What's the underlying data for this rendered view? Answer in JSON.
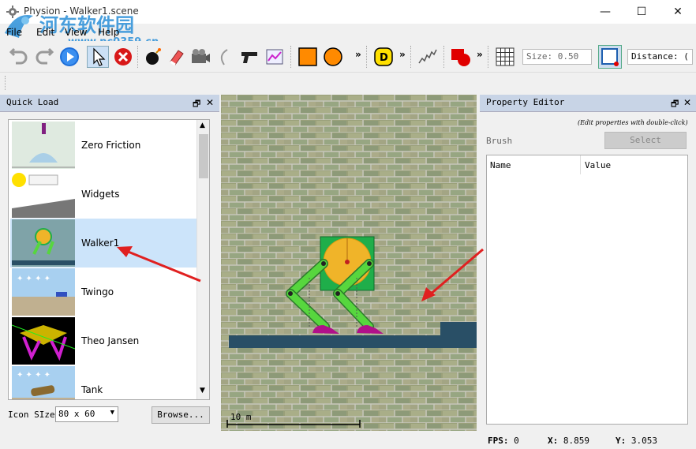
{
  "window": {
    "title": "Physion - Walker1.scene",
    "minimize": "—",
    "maximize": "☐",
    "close": "✕"
  },
  "menu": {
    "file": "File",
    "edit": "Edit",
    "view": "View",
    "help": "Help"
  },
  "watermark": {
    "line1": "河东软件园",
    "line2": "www.pc0359.cn"
  },
  "toolbar": {
    "overflow": "»",
    "size_value": "Size: 0.50",
    "distance_value": "Distance: (",
    "icons": [
      "undo-icon",
      "redo-icon",
      "play-icon",
      "pointer-icon",
      "delete-icon",
      "bomb-icon",
      "eraser-icon",
      "camera-icon",
      "rope-icon",
      "gun-icon",
      "graph-icon",
      "square-icon",
      "circle-icon",
      "d-icon",
      "spring-icon",
      "shape-icon",
      "grid-icon",
      "snap-icon"
    ],
    "colors": {
      "square": "#ff8a00",
      "circle": "#ff8a00",
      "d_badge": "#ffe000",
      "shape": "#e00000",
      "accent": "#1e6fd9"
    }
  },
  "quick_load": {
    "title": "Quick Load",
    "float": "🗗",
    "close": "✕",
    "items": [
      {
        "label": "Zero Friction"
      },
      {
        "label": "Widgets"
      },
      {
        "label": "Walker1",
        "selected": true
      },
      {
        "label": "Twingo"
      },
      {
        "label": "Theo Jansen"
      },
      {
        "label": "Tank"
      }
    ],
    "icon_size_label": "Icon SIze",
    "icon_size_value": "80 x 60",
    "browse": "Browse..."
  },
  "scene": {
    "scale_label": "10 m",
    "colors": {
      "ground": "#294f66",
      "wheel": "#f0b429",
      "frame": "#1fae4a",
      "legs": "#57d63e",
      "feet": "#b0108a"
    }
  },
  "property_editor": {
    "title": "Property Editor",
    "float": "🗗",
    "close": "✕",
    "hint": "(Edit properties with double-click)",
    "brush_label": "Brush",
    "select_button": "Select",
    "col_name": "Name",
    "col_value": "Value"
  },
  "status": {
    "fps_label": "FPS:",
    "fps_value": "0",
    "x_label": "X:",
    "x_value": "8.859",
    "y_label": "Y:",
    "y_value": "3.053"
  }
}
